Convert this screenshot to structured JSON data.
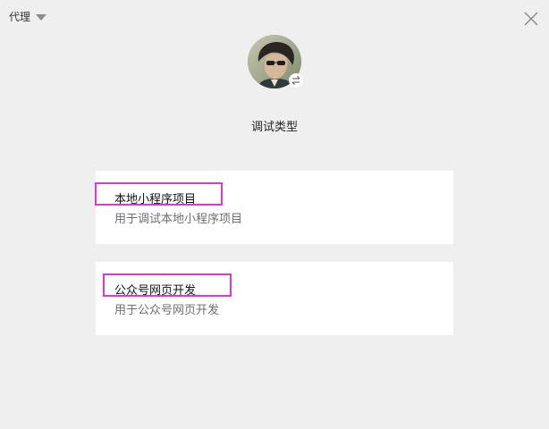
{
  "header": {
    "proxy_label": "代理",
    "proxy_icon": "caret-down-icon",
    "close_icon": "close-icon"
  },
  "user": {
    "avatar_icon": "user-avatar",
    "switch_icon": "switch-arrows-icon"
  },
  "page": {
    "title": "调试类型"
  },
  "options": [
    {
      "name": "本地小程序项目",
      "description": "用于调试本地小程序项目"
    },
    {
      "name": "公众号网页开发",
      "description": "用于公众号网页开发"
    }
  ],
  "colors": {
    "background": "#efefef",
    "card": "#ffffff",
    "highlight": "#d63ad6",
    "description_text": "#6e6e6e"
  }
}
